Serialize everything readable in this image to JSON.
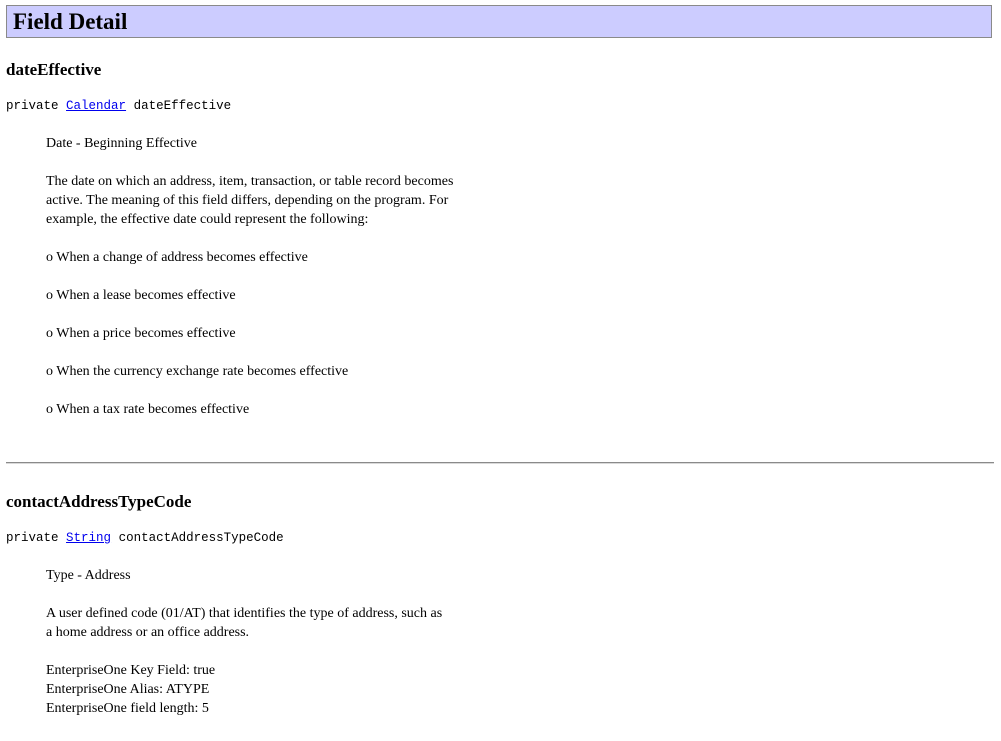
{
  "header": {
    "title": "Field Detail"
  },
  "fields": [
    {
      "name": "dateEffective",
      "modifier": "private",
      "type_link": "Calendar",
      "field_identifier": "dateEffective",
      "short_desc": "Date - Beginning Effective",
      "long_desc_lines": [
        "The date on which an address, item, transaction, or table record becomes",
        "active. The meaning of this field differs, depending on the program. For",
        "example, the effective date could represent the following:"
      ],
      "bullets": [
        "o When a change of address becomes effective",
        "o When a lease becomes effective",
        "o When a price becomes effective",
        "o When the currency exchange rate becomes effective",
        "o When a tax rate becomes effective"
      ]
    },
    {
      "name": "contactAddressTypeCode",
      "modifier": "private",
      "type_link": "String",
      "field_identifier": "contactAddressTypeCode",
      "short_desc": "Type - Address",
      "long_desc_lines": [
        "A user defined code (01/AT) that identifies the type of address, such as",
        "a home address or an office address."
      ],
      "meta_lines": [
        "EnterpriseOne Key Field: true",
        "EnterpriseOne Alias: ATYPE",
        "EnterpriseOne field length: 5"
      ]
    }
  ]
}
